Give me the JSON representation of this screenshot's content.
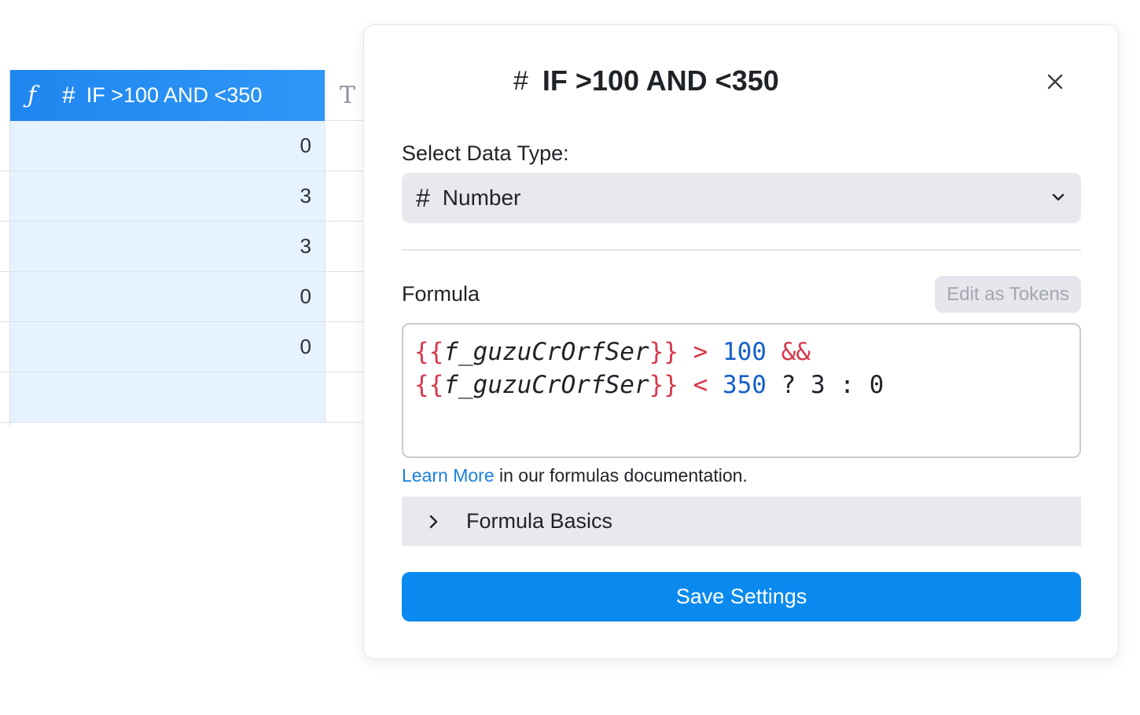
{
  "grid": {
    "column_header": {
      "formula_icon": "function-f-icon",
      "type_icon": "hash-icon",
      "title": "IF >100 AND <350"
    },
    "next_column_icon": "text-type-icon",
    "rows": [
      {
        "value": "0"
      },
      {
        "value": "3"
      },
      {
        "value": "3"
      },
      {
        "value": "0"
      },
      {
        "value": "0"
      },
      {
        "value": ""
      }
    ]
  },
  "panel": {
    "title_icon": "hash-icon",
    "title": "IF >100 AND <350",
    "close_icon": "close-icon",
    "data_type_label": "Select Data Type:",
    "data_type_select": {
      "icon": "hash-icon",
      "selected": "Number"
    },
    "formula_label": "Formula",
    "edit_tokens_label": "Edit as Tokens",
    "formula": {
      "line1": {
        "brace_open": "{{",
        "ref": "f_guzuCrOrfSer",
        "brace_close": "}}",
        "op1": " > ",
        "num": "100",
        "op2": " &&"
      },
      "line2": {
        "brace_open": "{{",
        "ref": "f_guzuCrOrfSer",
        "brace_close": "}}",
        "op1": " < ",
        "num": "350",
        "rest": " ? 3 : 0"
      }
    },
    "help": {
      "link": "Learn More",
      "text": " in our formulas documentation."
    },
    "basics_label": "Formula Basics",
    "save_label": "Save Settings"
  },
  "colors": {
    "accent": "#0a8aef",
    "header_blue": "#1f86ef",
    "cell_highlight": "#e6f2ff",
    "token_red": "#d7374b",
    "number_blue": "#1560c9"
  }
}
